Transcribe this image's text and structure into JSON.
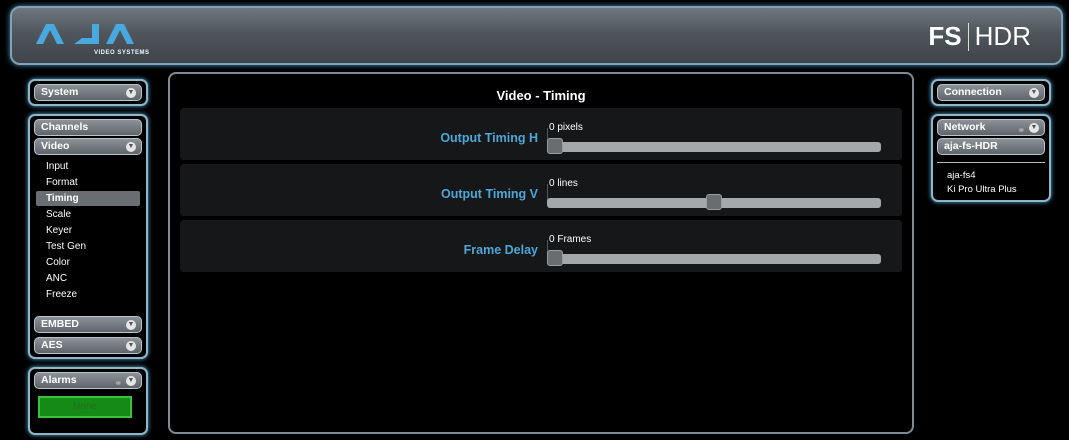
{
  "header": {
    "logo_text": "AJA",
    "logo_sub": "VIDEO SYSTEMS",
    "product_fs": "FS",
    "product_hdr": "HDR"
  },
  "left": {
    "system": "System",
    "channels": "Channels",
    "video": "Video",
    "video_items": [
      "Input",
      "Format",
      "Timing",
      "Scale",
      "Keyer",
      "Test Gen",
      "Color",
      "ANC",
      "Freeze"
    ],
    "selected_item": "Timing",
    "embed": "EMBED",
    "aes": "AES",
    "alarms": "Alarms",
    "alarm_status": "None"
  },
  "main": {
    "title": "Video - Timing",
    "rows": [
      {
        "label": "Output Timing H",
        "value": "0 pixels",
        "level": 0.0
      },
      {
        "label": "Output Timing V",
        "value": "0 lines",
        "level": 0.5
      },
      {
        "label": "Frame Delay",
        "value": "0 Frames",
        "level": 0.0
      }
    ]
  },
  "right": {
    "connection": "Connection",
    "network": "Network",
    "selected_device": "aja-fs-HDR",
    "devices": [
      "aja-fs4",
      "Ki Pro Ultra Plus"
    ]
  },
  "colors": {
    "accent_label": "#4fa7d8",
    "panel_glow": "#5aa8d6",
    "alarm_green": "#168a16"
  }
}
